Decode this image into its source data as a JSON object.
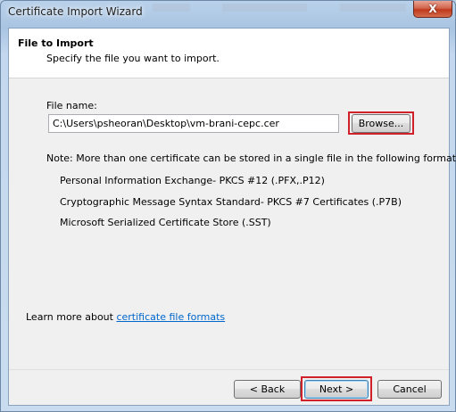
{
  "window": {
    "title": "Certificate Import Wizard",
    "close_glyph": "X"
  },
  "header": {
    "title": "File to Import",
    "subtitle": "Specify the file you want to import."
  },
  "form": {
    "file_label": "File name:",
    "file_value": "C:\\Users\\psheoran\\Desktop\\vm-brani-cepc.cer",
    "browse_label": "Browse..."
  },
  "note": {
    "intro": "Note:  More than one certificate can be stored in a single file in the following formats:",
    "formats": [
      "Personal Information Exchange- PKCS #12 (.PFX,.P12)",
      "Cryptographic Message Syntax Standard- PKCS #7 Certificates (.P7B)",
      "Microsoft Serialized Certificate Store (.SST)"
    ]
  },
  "learn_more": {
    "prefix": "Learn more about ",
    "link": "certificate file formats"
  },
  "footer": {
    "back_label": "< Back",
    "next_label": "Next >",
    "cancel_label": "Cancel"
  },
  "colors": {
    "highlight": "#d0202a",
    "link": "#0066cc",
    "close_button": "#c0391c"
  }
}
